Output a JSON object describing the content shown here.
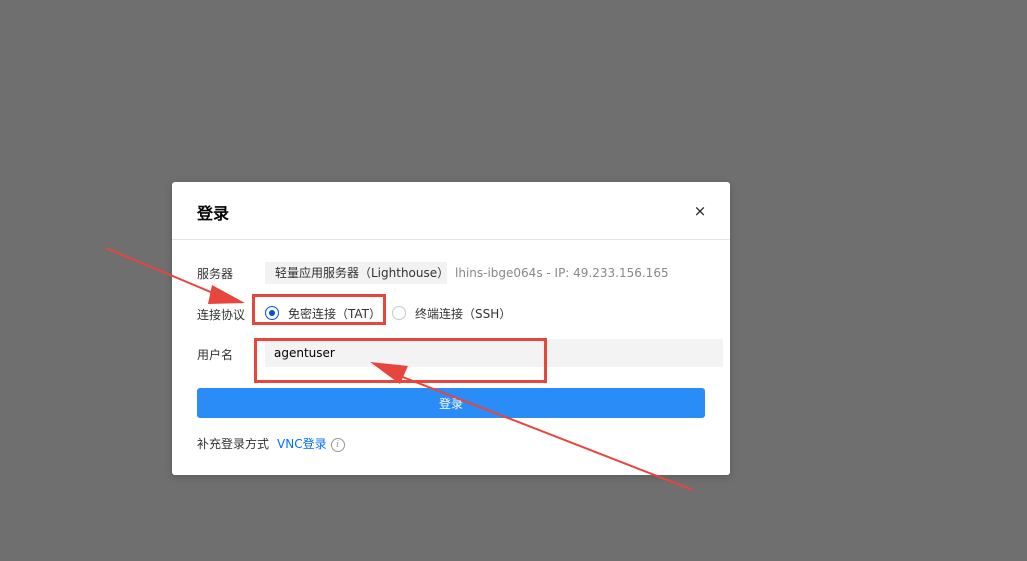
{
  "dialog": {
    "title": "登录",
    "close_symbol": "×"
  },
  "form": {
    "server_label": "服务器",
    "server_name": "轻量应用服务器（Lighthouse）",
    "server_info": "lhins-ibge064s - IP: 49.233.156.165",
    "protocol_label": "连接协议",
    "protocols": [
      {
        "label": "免密连接（TAT）",
        "selected": true
      },
      {
        "label": "终端连接（SSH）",
        "selected": false
      }
    ],
    "username_label": "用户名",
    "username_value": "agentuser",
    "login_button": "登录",
    "extra_login_label": "补充登录方式",
    "vnc_link": "VNC登录",
    "info_symbol": "i"
  },
  "colors": {
    "overlay": "#6f6f6f",
    "primary_button": "#2a8cf7",
    "link": "#006eff",
    "radio_checked": "#0052d9",
    "annotation": "#e8453c"
  },
  "icons": {
    "close": "close-icon",
    "info": "info-icon",
    "radio_checked": "radio-checked-icon",
    "radio_unchecked": "radio-unchecked-icon"
  }
}
